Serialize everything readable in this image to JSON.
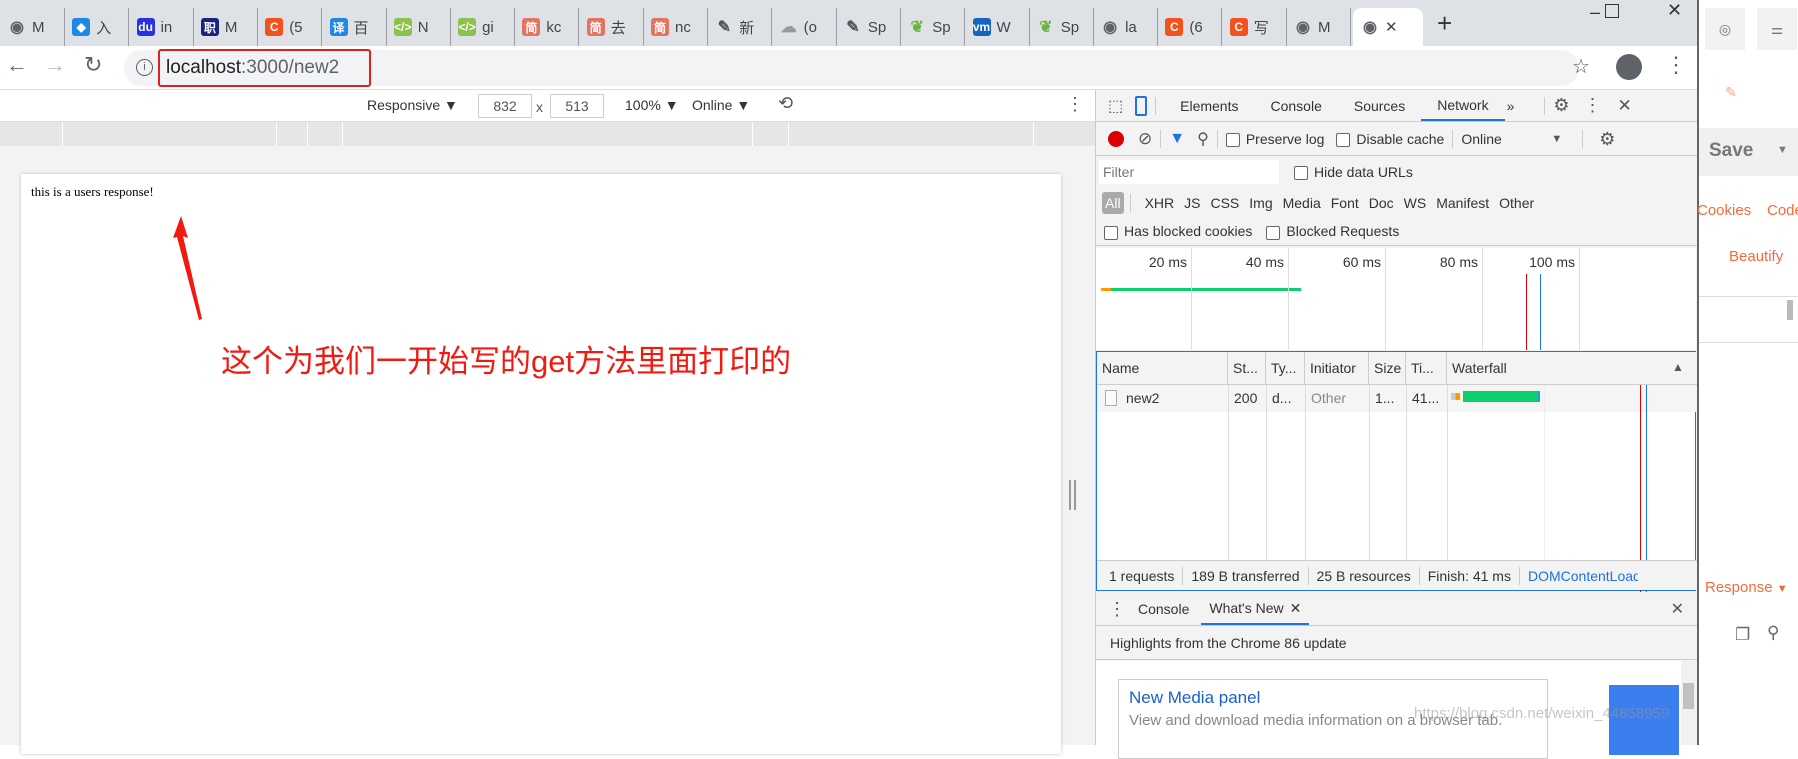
{
  "browser": {
    "tabs": [
      {
        "label": "M",
        "icon": "globe-icon",
        "color": "#5f6368"
      },
      {
        "label": "入",
        "icon": "cube-icon",
        "color": "#1e88e5"
      },
      {
        "label": "in",
        "icon": "baidu-icon",
        "color": "#2932e1"
      },
      {
        "label": "M",
        "icon": "zhi-icon",
        "color": "#1a237e"
      },
      {
        "label": "(5",
        "icon": "csdn-icon",
        "color": "#f4511e"
      },
      {
        "label": "百",
        "icon": "translate-icon",
        "color": "#1e88e5"
      },
      {
        "label": "N",
        "icon": "code-icon",
        "color": "#8bc34a"
      },
      {
        "label": "gi",
        "icon": "code-icon",
        "color": "#8bc34a"
      },
      {
        "label": "kc",
        "icon": "jian-icon",
        "color": "#e57361"
      },
      {
        "label": "去",
        "icon": "jian-icon",
        "color": "#e57361"
      },
      {
        "label": "nc",
        "icon": "jian-icon",
        "color": "#e57361"
      },
      {
        "label": "新",
        "icon": "feather-icon",
        "color": "#555"
      },
      {
        "label": "(o",
        "icon": "cloud-icon",
        "color": "#999"
      },
      {
        "label": "Sp",
        "icon": "feather-icon",
        "color": "#555"
      },
      {
        "label": "Sp",
        "icon": "spring-icon",
        "color": "#6db33f"
      },
      {
        "label": "W",
        "icon": "vmware-icon",
        "color": "#1565c0"
      },
      {
        "label": "Sp",
        "icon": "spring-icon",
        "color": "#6db33f"
      },
      {
        "label": "la",
        "icon": "globe-icon",
        "color": "#5f6368"
      },
      {
        "label": "(6",
        "icon": "csdn-icon",
        "color": "#f4511e"
      },
      {
        "label": "写",
        "icon": "csdn-icon",
        "color": "#f4511e"
      },
      {
        "label": "M",
        "icon": "globe-icon",
        "color": "#5f6368"
      }
    ],
    "tab_glyphs": {
      "globe-icon": "◉",
      "cube-icon": "◆",
      "baidu-icon": "du",
      "zhi-icon": "职",
      "csdn-icon": "C",
      "translate-icon": "译",
      "code-icon": "</>",
      "jian-icon": "简",
      "feather-icon": "✎",
      "cloud-icon": "☁",
      "spring-icon": "❦",
      "vmware-icon": "vm"
    },
    "url_host": "localhost",
    "url_path": ":3000/new2"
  },
  "device_toolbar": {
    "device": "Responsive ▼",
    "width": "832",
    "x": "x",
    "height": "513",
    "zoom": "100% ▼",
    "throttle": "Online ▼"
  },
  "page": {
    "response_text": "this is a users response!",
    "annotation": "这个为我们一开始写的get方法里面打印的"
  },
  "devtools": {
    "tabs": [
      "Elements",
      "Console",
      "Sources",
      "Network"
    ],
    "more": "»",
    "preserve_log": "Preserve log",
    "disable_cache": "Disable cache",
    "throttle": "Online",
    "filter_placeholder": "Filter",
    "hide_data_urls": "Hide data URLs",
    "types": [
      "All",
      "XHR",
      "JS",
      "CSS",
      "Img",
      "Media",
      "Font",
      "Doc",
      "WS",
      "Manifest",
      "Other"
    ],
    "has_blocked_cookies": "Has blocked cookies",
    "blocked_requests": "Blocked Requests",
    "overview_ticks": [
      "20 ms",
      "40 ms",
      "60 ms",
      "80 ms",
      "100 ms"
    ],
    "columns": [
      "Name",
      "St...",
      "Ty...",
      "Initiator",
      "Size",
      "Ti...",
      "Waterfall"
    ],
    "rows": [
      {
        "name": "new2",
        "status": "200",
        "type": "d...",
        "initiator": "Other",
        "size": "1...",
        "time": "41..."
      }
    ],
    "summary": [
      "1 requests",
      "189 B transferred",
      "25 B resources",
      "Finish: 41 ms",
      "DOMContentLoaded"
    ],
    "drawer_tabs": [
      "Console",
      "What's New"
    ],
    "highlights": "Highlights from the Chrome 86 update",
    "card_title": "New Media panel",
    "card_text": "View and download media information on a browser tab."
  },
  "side": {
    "save": "Save",
    "cookies": "Cookies",
    "code": "Code",
    "beautify": "Beautify",
    "response": "Response"
  },
  "watermark": "https://blog.csdn.net/weixin_44858959"
}
